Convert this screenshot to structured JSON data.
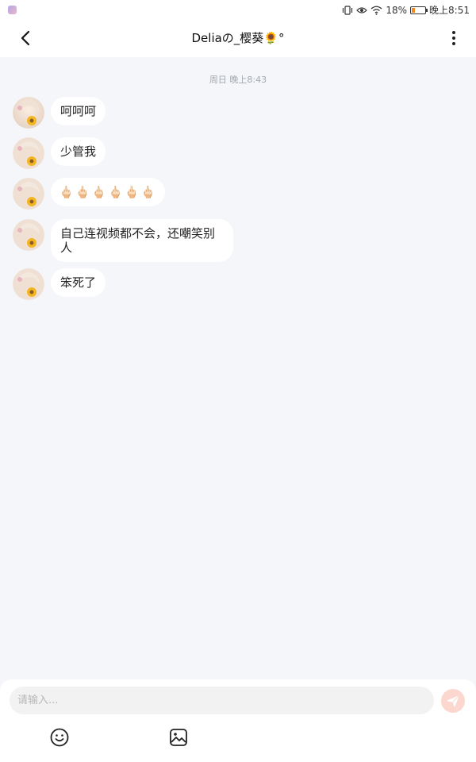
{
  "status_bar": {
    "battery_percent": "18%",
    "time": "晚上8:51",
    "icons": [
      "app-icon",
      "vibrate-icon",
      "eye-icon",
      "wifi-icon",
      "battery-icon"
    ]
  },
  "header": {
    "title": "Deliaの_樱葵🌻°",
    "back_icon": "chevron-left-icon",
    "more_icon": "more-vertical-icon"
  },
  "chat": {
    "timestamp": "周日 晚上8:43",
    "messages": [
      {
        "sender": "incoming",
        "text": "呵呵呵"
      },
      {
        "sender": "incoming",
        "text": "少管我"
      },
      {
        "sender": "incoming",
        "text": "🖕🏻🖕🏻🖕🏻🖕🏻🖕🏻🖕🏻"
      },
      {
        "sender": "incoming",
        "text": "自己连视频都不会，还嘲笑别人"
      },
      {
        "sender": "incoming",
        "text": "笨死了"
      }
    ]
  },
  "composer": {
    "placeholder": "请输入...",
    "value": "",
    "send_icon": "send-icon",
    "emoji_icon": "emoji-icon",
    "image_icon": "image-icon"
  },
  "colors": {
    "background": "#f4f6f9",
    "bubble": "#ffffff",
    "send_button": "#fbd7cf",
    "send_glyph": "#ffffff"
  }
}
